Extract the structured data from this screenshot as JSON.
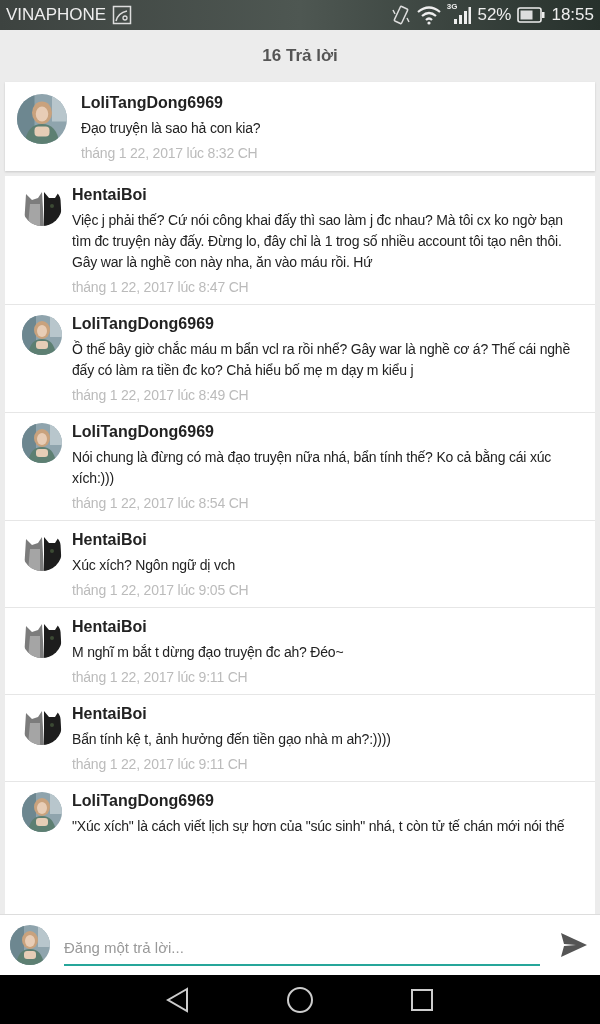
{
  "status_bar": {
    "carrier": "VINAPHONE",
    "network": "3G",
    "battery": "52%",
    "time": "18:55"
  },
  "header": {
    "title": "16 Trả lời"
  },
  "parent": {
    "author": "LoliTangDong6969",
    "text": "Đạo truyện là sao hả con kia?",
    "time": "tháng 1 22, 2017 lúc 8:32 CH"
  },
  "replies": [
    {
      "author": "HentaiBoi",
      "text": "Việc j phải thế? Cứ nói công khai đấy thì sao làm j đc nhau? Mà tôi cx ko ngờ bạn tìm đc truyện này đấy. Đừng lo, đây chỉ là 1 trog số nhiều account tôi tạo nên thôi. Gây war là nghề con này nha, ăn vào máu rồi. Hứ",
      "time": "tháng 1 22, 2017 lúc 8:47 CH"
    },
    {
      "author": "LoliTangDong6969",
      "text": "Ồ thế bây giờ chắc máu m bẩn vcl ra rồi nhể? Gây war là nghề cơ á? Thế cái nghề đấy có làm ra tiền đc ko? Chả hiểu bố mẹ m dạy m kiểu j",
      "time": "tháng 1 22, 2017 lúc 8:49 CH"
    },
    {
      "author": "LoliTangDong6969",
      "text": "Nói chung là đừng có mà đạo truyện nữa nhá, bẩn tính thế? Ko cả bằng cái xúc xích:)))",
      "time": "tháng 1 22, 2017 lúc 8:54 CH"
    },
    {
      "author": "HentaiBoi",
      "text": "Xúc xích? Ngôn ngữ dị vch",
      "time": "tháng 1 22, 2017 lúc 9:05 CH"
    },
    {
      "author": "HentaiBoi",
      "text": "M nghĩ m bắt t dừng đạo truyện đc ah? Đéo~",
      "time": "tháng 1 22, 2017 lúc 9:11 CH"
    },
    {
      "author": "HentaiBoi",
      "text": "Bẩn tính kệ t, ảnh hưởng đến tiền gạo nhà m ah?:))))",
      "time": "tháng 1 22, 2017 lúc 9:11 CH"
    },
    {
      "author": "LoliTangDong6969",
      "text": "\"Xúc xích\" là cách viết lịch sự hơn của \"súc sinh\" nhá, t còn tử tế chán mới nói thế"
    }
  ],
  "reply_box": {
    "placeholder": "Đăng một trả lời..."
  }
}
